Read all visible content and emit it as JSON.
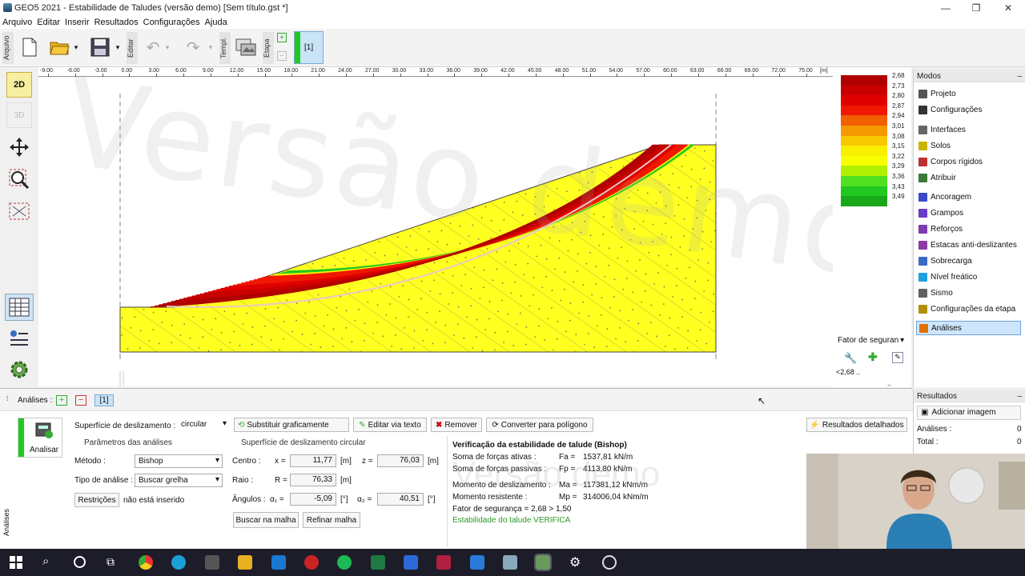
{
  "window": {
    "title": "GEO5 2021 - Estabilidade de Taludes (versão demo) [Sem título.gst *]",
    "minimize": "—",
    "maximize": "❐",
    "close": "✕"
  },
  "menu": [
    "Arquivo",
    "Editar",
    "Inserir",
    "Resultados",
    "Configurações",
    "Ajuda"
  ],
  "toolbar": {
    "tab_arquivo": "Arquivo",
    "tab_editar": "Editar",
    "tab_templ": "Templ.",
    "tab_etapa": "Etapa",
    "stage_label": "[1]"
  },
  "ruler": {
    "unit": "[m]",
    "ticks": [
      "-9.00",
      "-6.00",
      "-3.00",
      "0.00",
      "3.00",
      "6.00",
      "9.00",
      "12.00",
      "15.00",
      "18.00",
      "21.00",
      "24.00",
      "27.00",
      "30.00",
      "33.00",
      "36.00",
      "39.00",
      "42.00",
      "45.00",
      "48.00",
      "51.00",
      "54.00",
      "57.00",
      "60.00",
      "63.00",
      "66.00",
      "69.00",
      "72.00",
      "75.00"
    ]
  },
  "left_tools": {
    "mode_2d": "2D",
    "mode_3d": "3D"
  },
  "watermark": "Versão demo",
  "legend": {
    "values": [
      "2,68",
      "2,73",
      "2,80",
      "2,87",
      "2,94",
      "3,01",
      "3,08",
      "3,15",
      "3,22",
      "3,29",
      "3,36",
      "3,43",
      "3,49"
    ],
    "colors": [
      "#b00000",
      "#c80000",
      "#e00000",
      "#f01800",
      "#f06000",
      "#f49a00",
      "#f8c800",
      "#f8f000",
      "#f8ff00",
      "#b0f000",
      "#50e020",
      "#20c820",
      "#18a818"
    ],
    "dropdown": "Fator de seguran",
    "min_label": "<2,68 ..",
    "max_label": ".. 3,49>"
  },
  "modes": {
    "header": "Modos",
    "items": [
      {
        "label": "Projeto",
        "color": "#555"
      },
      {
        "label": "Configurações",
        "color": "#333"
      },
      {
        "label": "Interfaces",
        "color": "#666"
      },
      {
        "label": "Solos",
        "color": "#c8b400"
      },
      {
        "label": "Corpos rígidos",
        "color": "#c03030"
      },
      {
        "label": "Atribuir",
        "color": "#3a7a3a"
      },
      {
        "label": "Ancoragem",
        "color": "#3a4ac8"
      },
      {
        "label": "Grampos",
        "color": "#6a3ac8"
      },
      {
        "label": "Reforços",
        "color": "#7a3ab0"
      },
      {
        "label": "Estacas anti-deslizantes",
        "color": "#8a3aa0"
      },
      {
        "label": "Sobrecarga",
        "color": "#3a6ac8"
      },
      {
        "label": "Nível freático",
        "color": "#20a0e0"
      },
      {
        "label": "Sismo",
        "color": "#606060"
      },
      {
        "label": "Configurações da etapa",
        "color": "#b09000"
      },
      {
        "label": "Análises",
        "color": "#e07000"
      }
    ]
  },
  "analysis": {
    "tab_label": "Análises :",
    "stage": "[1]",
    "analyze_button": "Analisar",
    "side_tab": "Análises",
    "slip_surface_label": "Superfície de deslizamento :",
    "slip_surface_value": "circular",
    "btn_substituir": "Substituir graficamente",
    "btn_editar_texto": "Editar via texto",
    "btn_remover": "Remover",
    "btn_converter": "Converter para polígono",
    "btn_resultados": "Resultados detalhados",
    "params_header": "Parâmetros das análises",
    "metodo_label": "Método :",
    "metodo_value": "Bishop",
    "tipo_label": "Tipo de análise :",
    "tipo_value": "Buscar grelha",
    "restricoes_button": "Restrições",
    "restricoes_status": "não está inserido",
    "circ_header": "Superfície de deslizamento circular",
    "centro_label": "Centro :",
    "x_label": "x =",
    "x_value": "11,77",
    "z_label": "z =",
    "z_value": "76,03",
    "unit_m": "[m]",
    "raio_label": "Raio :",
    "r_label": "R =",
    "r_value": "76,33",
    "angulos_label": "Ângulos :",
    "a1_label": "α₁ =",
    "a1_value": "-5,09",
    "a2_label": "α₂ =",
    "a2_value": "40,51",
    "unit_deg": "[°]",
    "btn_buscar": "Buscar na malha",
    "btn_refinar": "Refinar malha"
  },
  "verification": {
    "title": "Verificação da estabilidade de talude (Bishop)",
    "rows": [
      {
        "label": "Soma de forças ativas :",
        "sym": "Fa =",
        "value": "1537,81  kN/m"
      },
      {
        "label": "Soma de forças passivas :",
        "sym": "Fp =",
        "value": "4113,80  kN/m"
      },
      {
        "label": "Momento de deslizamento :",
        "sym": "Ma =",
        "value": "117381,12  kNm/m"
      },
      {
        "label": "Momento resistente :",
        "sym": "Mp =",
        "value": "314006,04  kNm/m"
      }
    ],
    "fs_line": "Fator de segurança = 2,68 > 1,50",
    "verdict": "Estabilidade do talude VERIFICA"
  },
  "results_panel": {
    "header": "Resultados",
    "add_image": "Adicionar imagem",
    "analises_label": "Análises :",
    "analises_value": "0",
    "total_label": "Total :",
    "total_value": "0"
  }
}
